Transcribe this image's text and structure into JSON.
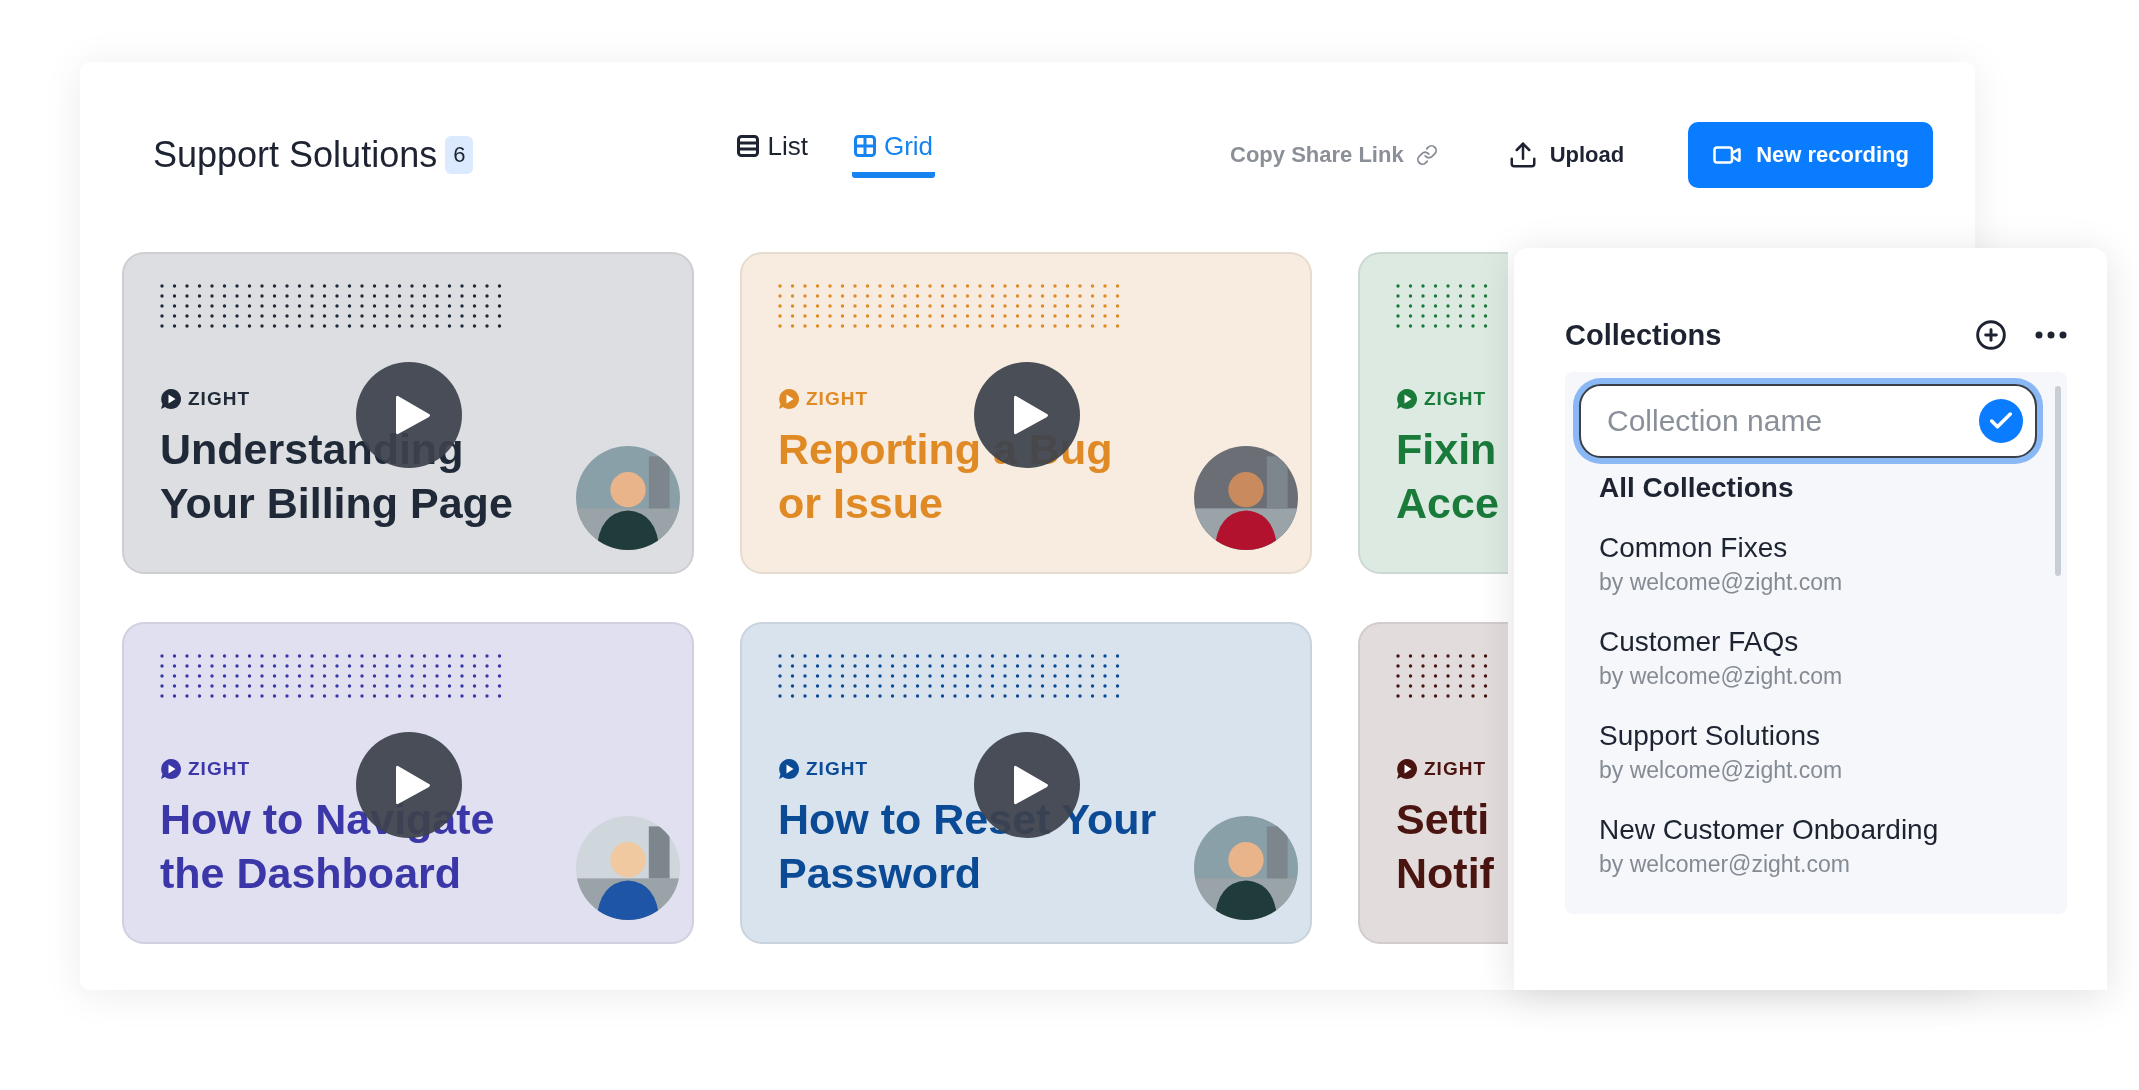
{
  "header": {
    "title": "Support Solutions",
    "count": "6"
  },
  "view_tabs": [
    {
      "label": "List",
      "selected": false
    },
    {
      "label": "Grid",
      "selected": true
    }
  ],
  "actions": {
    "share": "Copy Share Link",
    "upload": "Upload",
    "record": "New recording"
  },
  "cards": [
    {
      "brand": "ZIGHT",
      "title": "Understanding\nYour Billing Page",
      "color": "#1f2937"
    },
    {
      "brand": "ZIGHT",
      "title": "Reporting a Bug\nor Issue",
      "color": "#e08a25"
    },
    {
      "brand": "ZIGHT",
      "title": "Fixin\nAcce",
      "color": "#1a7a3a"
    },
    {
      "brand": "ZIGHT",
      "title": "How to Navigate\nthe Dashboard",
      "color": "#3b37a8"
    },
    {
      "brand": "ZIGHT",
      "title": "How to Reset Your\nPassword",
      "color": "#0b4a95"
    },
    {
      "brand": "ZIGHT",
      "title": "Setti\nNotif",
      "color": "#4a1410"
    }
  ],
  "collections": {
    "title": "Collections",
    "input": {
      "placeholder": "Collection name"
    },
    "items": [
      {
        "kind": "header",
        "name": "All Collections"
      },
      {
        "kind": "item",
        "name": "Common Fixes",
        "owner": "by welcome@zight.com"
      },
      {
        "kind": "item",
        "name": "Customer FAQs",
        "owner": "by welcome@zight.com"
      },
      {
        "kind": "item",
        "name": "Support Solutions",
        "owner": "by welcome@zight.com"
      },
      {
        "kind": "item",
        "name": "New Customer Onboarding",
        "owner": "by welcomer@zight.com"
      }
    ]
  }
}
